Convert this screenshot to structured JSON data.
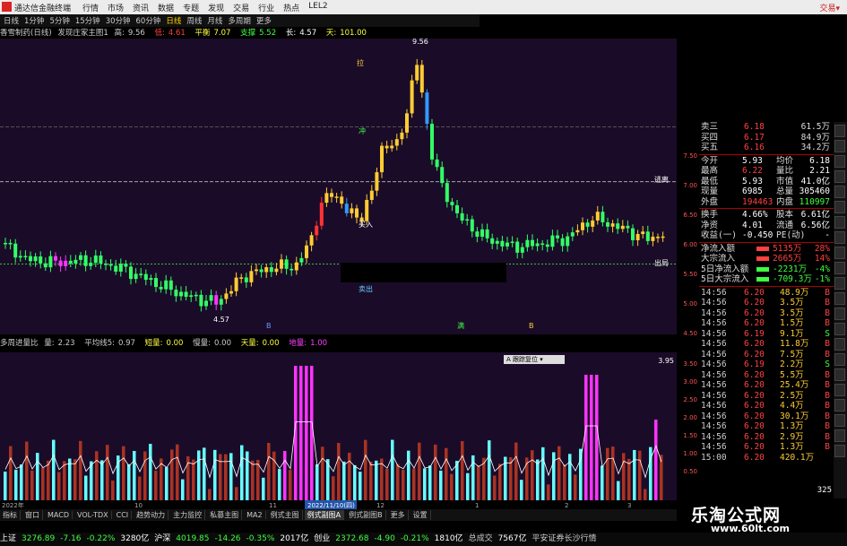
{
  "titlebar": {
    "app_name": "通达信金融终端",
    "menu": [
      "行情",
      "市场",
      "资讯",
      "数据",
      "专题",
      "发现",
      "交易",
      "行业",
      "热点",
      "LEL2"
    ],
    "right_text": "交易▾"
  },
  "periods": [
    "日线",
    "1分钟",
    "5分钟",
    "15分钟",
    "30分钟",
    "60分钟",
    "日线",
    "周线",
    "月线",
    "多周期",
    "更多"
  ],
  "period_active_index": 6,
  "info": {
    "stock": "香雪制药(日线)",
    "indicator": "发现庄家主图1",
    "high_label": "高:",
    "high": "9.56",
    "low_label": "低:",
    "low": "4.61",
    "mid_label": "平衡",
    "mid": "7.07",
    "support_label": "支撑",
    "support": "5.52",
    "long_label": "长:",
    "long": "4.57",
    "sky_label": "天:",
    "sky": "101.00"
  },
  "main_labels": {
    "top_price": "9.56",
    "bottom_price": "4.57",
    "buy_text": "买入",
    "sell_text": "卖出",
    "la": "拉",
    "chong": "冲",
    "escape": "逃离",
    "exit": "出局",
    "m1": "B",
    "m2": "满",
    "m3": "B"
  },
  "vol_header": {
    "name": "多周进量比",
    "ratio_label": "量:",
    "ratio": "2.23",
    "avg_label": "平均线5:",
    "avg": "0.97",
    "short_label": "短量:",
    "short": "0.00",
    "slow_label": "慢量:",
    "slow": "0.00",
    "sky_label": "天量:",
    "sky": "0.00",
    "ground_label": "地量:",
    "ground": "1.00"
  },
  "vol_max_label": "3.95",
  "float_button": "A 跟踪复位 ▾",
  "date_label": "2022/11/10(四)",
  "dates": [
    "2022年",
    "10",
    "11",
    "12",
    "1",
    "2",
    "3"
  ],
  "price_axis": [
    "7.50",
    "7.00",
    "6.50",
    "6.00",
    "5.50",
    "5.00",
    "4.50"
  ],
  "vol_axis": [
    "3.50",
    "3.00",
    "2.50",
    "2.00",
    "1.50",
    "1.00",
    "0.50"
  ],
  "quote_top": [
    {
      "label": "卖三",
      "price": "6.18",
      "vol": "61.5万"
    },
    {
      "label": "买四",
      "price": "6.17",
      "vol": "84.9万"
    },
    {
      "label": "买五",
      "price": "6.16",
      "vol": "34.2万"
    }
  ],
  "quote_stats": [
    {
      "l1": "今开",
      "v1": "5.93",
      "l2": "均价",
      "v2": "6.18"
    },
    {
      "l1": "最高",
      "v1": "6.22",
      "l2": "量比",
      "v2": "2.21"
    },
    {
      "l1": "最低",
      "v1": "5.93",
      "l2": "市值",
      "v2": "41.0亿"
    },
    {
      "l1": "现量",
      "v1": "6985",
      "l2": "总量",
      "v2": "305460"
    },
    {
      "l1": "外盘",
      "v1": "194463",
      "l2": "内盘",
      "v2": "110997"
    }
  ],
  "quote_stats2": [
    {
      "l1": "换手",
      "v1": "4.66%",
      "l2": "股本",
      "v2": "6.61亿"
    },
    {
      "l1": "净资",
      "v1": "4.01",
      "l2": "流通",
      "v2": "6.56亿"
    },
    {
      "l1": "收益(一)",
      "v1": "-0.450",
      "l2": "PE(动)",
      "v2": "-"
    }
  ],
  "flows": [
    {
      "label": "净流入额",
      "value": "5135万",
      "pct": "28%",
      "color": "#ff4040"
    },
    {
      "label": "大宗流入",
      "value": "2665万",
      "pct": "14%",
      "color": "#ff4040"
    },
    {
      "label": "5日净流入额",
      "value": "-2231万",
      "pct": "-4%",
      "color": "#40ff40"
    },
    {
      "label": "5日大宗流入",
      "value": "-709.3万",
      "pct": "-1%",
      "color": "#40ff40"
    }
  ],
  "ticks": [
    {
      "t": "14:56",
      "p": "6.20",
      "v": "48.9万",
      "f": "B"
    },
    {
      "t": "14:56",
      "p": "6.20",
      "v": "3.5万",
      "f": "B"
    },
    {
      "t": "14:56",
      "p": "6.20",
      "v": "3.5万",
      "f": "B"
    },
    {
      "t": "14:56",
      "p": "6.20",
      "v": "1.5万",
      "f": "B"
    },
    {
      "t": "14:56",
      "p": "6.19",
      "p2": "",
      "v": "9.1万",
      "f": "S"
    },
    {
      "t": "14:56",
      "p": "6.20",
      "v": "11.8万",
      "f": "B"
    },
    {
      "t": "14:56",
      "p": "6.20",
      "v": "7.5万",
      "f": "B"
    },
    {
      "t": "14:56",
      "p": "6.19",
      "v": "2.2万",
      "f": "S"
    },
    {
      "t": "14:56",
      "p": "6.20",
      "v": "5.5万",
      "f": "B"
    },
    {
      "t": "14:56",
      "p": "6.20",
      "v": "25.4万",
      "f": "B"
    },
    {
      "t": "14:56",
      "p": "6.20",
      "v": "2.5万",
      "f": "B"
    },
    {
      "t": "14:56",
      "p": "6.20",
      "v": "4.4万",
      "f": "B"
    },
    {
      "t": "14:56",
      "p": "6.20",
      "v": "30.1万",
      "f": "B"
    },
    {
      "t": "14:56",
      "p": "6.20",
      "v": "1.3万",
      "f": "B"
    },
    {
      "t": "14:56",
      "p": "6.20",
      "v": "2.9万",
      "f": "B"
    },
    {
      "t": "14:56",
      "p": "6.20",
      "v": "1.3万",
      "f": "B"
    },
    {
      "t": "15:00",
      "p": "6.20",
      "v": "420.1万",
      "f": ""
    }
  ],
  "tick_count": "325",
  "tabs": [
    "指标",
    "窗口",
    "MACD",
    "VOL-TDX",
    "CCI",
    "趋势动力",
    "主力监控",
    "私募主图",
    "MA2",
    "例式主图",
    "例式副图A",
    "例式副图B",
    "更多",
    "设置"
  ],
  "tab_active_index": 10,
  "index_bar": [
    {
      "name": "上证",
      "val": "3276.89",
      "chg": "-7.16",
      "pct": "-0.22%",
      "amt": "3280亿"
    },
    {
      "name": "沪深",
      "val": "4019.85",
      "chg": "-14.26",
      "pct": "-0.35%",
      "amt": "2017亿"
    },
    {
      "name": "创业",
      "val": "2372.68",
      "chg": "-4.90",
      "pct": "-0.21%",
      "amt": "1810亿"
    }
  ],
  "total_label": "总成交",
  "total": "7567亿",
  "broker": "平安证券长沙行情",
  "watermark": {
    "name": "乐淘公式网",
    "url": "www.60lt.com"
  },
  "colors": {
    "up": "#ffcc33",
    "down": "#33ff66",
    "dn2": "#3399ff",
    "magenta": "#ff33ff",
    "cyan": "#66ffff",
    "red": "#ff3333"
  }
}
